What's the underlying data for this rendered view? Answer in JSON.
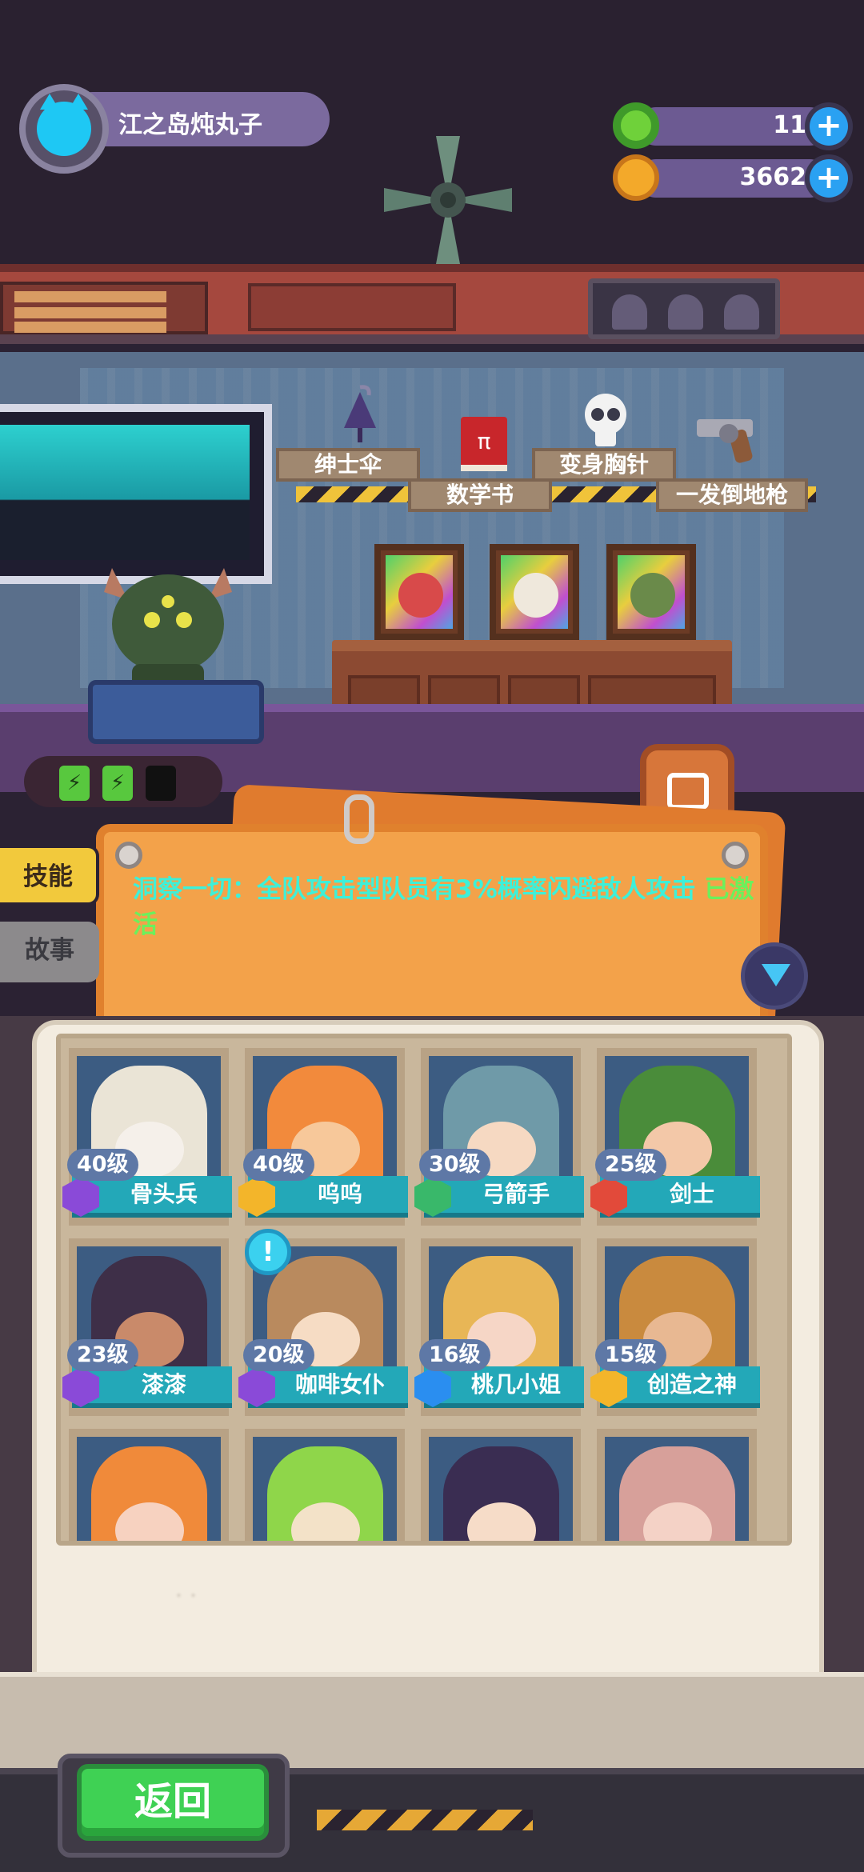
{
  "player": {
    "name": "江之岛炖丸子"
  },
  "currencies": [
    {
      "name": "gem",
      "amount": "11",
      "icon": "green-donut-icon",
      "color": "#6fd13a"
    },
    {
      "name": "coin",
      "amount": "3662",
      "icon": "planet-coin-icon",
      "color": "#f3a92a"
    }
  ],
  "items": [
    {
      "label": "绅士伞",
      "icon": "umbrella-icon"
    },
    {
      "label": "数学书",
      "icon": "book-icon"
    },
    {
      "label": "变身胸针",
      "icon": "skull-icon"
    },
    {
      "label": "一发倒地枪",
      "icon": "revolver-icon"
    }
  ],
  "battery": {
    "cells": [
      "⚡",
      "⚡"
    ],
    "charged": 2,
    "total": 3
  },
  "tabs": {
    "skill": "技能",
    "story": "故事"
  },
  "skill": {
    "text": "洞察一切：全队攻击型队员有3%概率闪避敌人攻击",
    "status": "已激活"
  },
  "characters": [
    {
      "level": "40级",
      "name": "骨头兵",
      "badge_color": "#8a4ad8",
      "art_color": "#eae4d6",
      "face_color": "#f5f0ea"
    },
    {
      "level": "40级",
      "name": "呜呜",
      "badge_color": "#f3b52a",
      "art_color": "#f28a3c",
      "face_color": "#f7c89a"
    },
    {
      "level": "30级",
      "name": "弓箭手",
      "badge_color": "#39b86a",
      "art_color": "#6f9aa8",
      "face_color": "#f6d9c2"
    },
    {
      "level": "25级",
      "name": "剑士",
      "badge_color": "#e24a3a",
      "art_color": "#4a8c3a",
      "face_color": "#f3c8a8"
    },
    {
      "level": "23级",
      "name": "漆漆",
      "badge_color": "#8a4ad8",
      "art_color": "#3e2f48",
      "face_color": "#c98a6a"
    },
    {
      "level": "20级",
      "name": "咖啡女仆",
      "badge_color": "#8a4ad8",
      "art_color": "#b98a5e",
      "face_color": "#f6dcc4",
      "alert": true
    },
    {
      "level": "16级",
      "name": "桃几小姐",
      "badge_color": "#2a8ef0",
      "art_color": "#e8b656",
      "face_color": "#f6d6c6"
    },
    {
      "level": "15级",
      "name": "创造之神",
      "badge_color": "#f3b52a",
      "art_color": "#c98a3e",
      "face_color": "#e8b892"
    },
    {
      "art_color": "#f08a3a",
      "face_color": "#f7d2c0"
    },
    {
      "art_color": "#8fd64a",
      "face_color": "#f3e2c8"
    },
    {
      "art_color": "#3a2d52",
      "face_color": "#f6dcc8"
    },
    {
      "art_color": "#d7a09a",
      "face_color": "#f4d2c6"
    }
  ],
  "footer_text": "·                                       ·",
  "back_button": "返回"
}
